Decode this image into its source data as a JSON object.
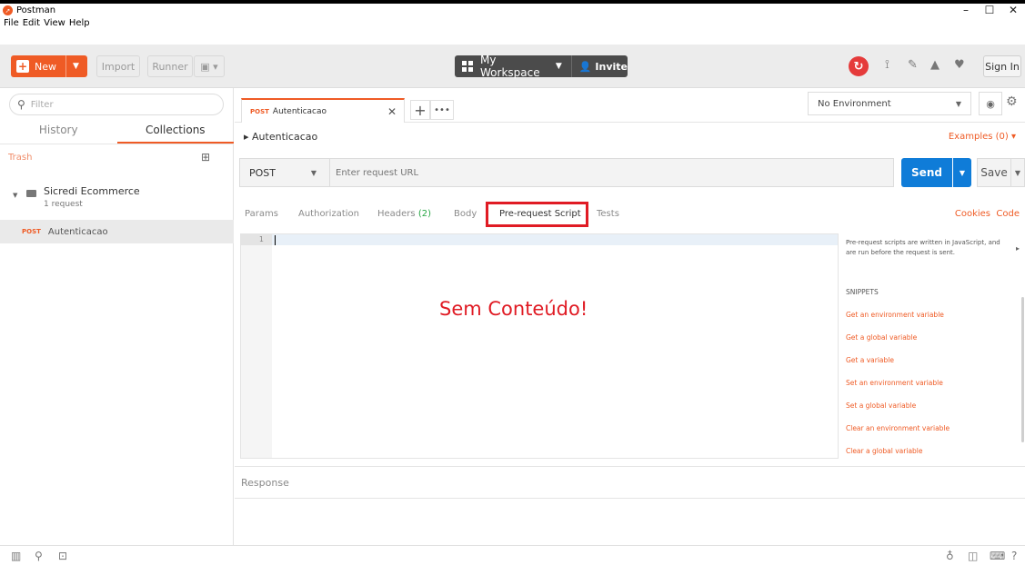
{
  "window": {
    "title": "Postman",
    "controls": [
      "–",
      "☐",
      "✕"
    ]
  },
  "menu": [
    "File",
    "Edit",
    "View",
    "Help"
  ],
  "toolbar": {
    "new_label": "New",
    "import_label": "Import",
    "runner_label": "Runner",
    "workspace_label": "My Workspace",
    "invite_label": "Invite",
    "signin_label": "Sign In"
  },
  "sidebar": {
    "filter_placeholder": "Filter",
    "tabs": [
      "History",
      "Collections"
    ],
    "trash_label": "Trash",
    "collection": {
      "name": "Sicredi Ecommerce",
      "count": "1 request"
    },
    "request": {
      "method": "POST",
      "name": "Autenticacao"
    }
  },
  "tabs": {
    "active": {
      "method": "POST",
      "name": "Autenticacao"
    }
  },
  "environment": {
    "selected": "No Environment"
  },
  "breadcrumb": "▸ Autenticacao",
  "examples_label": "Examples (0)",
  "request": {
    "method": "POST",
    "url_placeholder": "Enter request URL",
    "send_label": "Send",
    "save_label": "Save"
  },
  "subtabs": {
    "params": "Params",
    "authorization": "Authorization",
    "headers": "Headers",
    "headers_count": "(2)",
    "body": "Body",
    "prerequest": "Pre-request Script",
    "tests": "Tests",
    "cookies": "Cookies",
    "code": "Code"
  },
  "editor": {
    "line_number": "1",
    "overlay_text": "Sem Conteúdo!"
  },
  "snippets": {
    "description": "Pre-request scripts are written in JavaScript, and are run before the request is sent.",
    "heading": "SNIPPETS",
    "items": [
      "Get an environment variable",
      "Get a global variable",
      "Get a variable",
      "Set an environment variable",
      "Set a global variable",
      "Clear an environment variable",
      "Clear a global variable"
    ]
  },
  "response_label": "Response",
  "colors": {
    "accent": "#ef5b25",
    "send": "#0f7cd8",
    "highlight": "#e01b24"
  }
}
